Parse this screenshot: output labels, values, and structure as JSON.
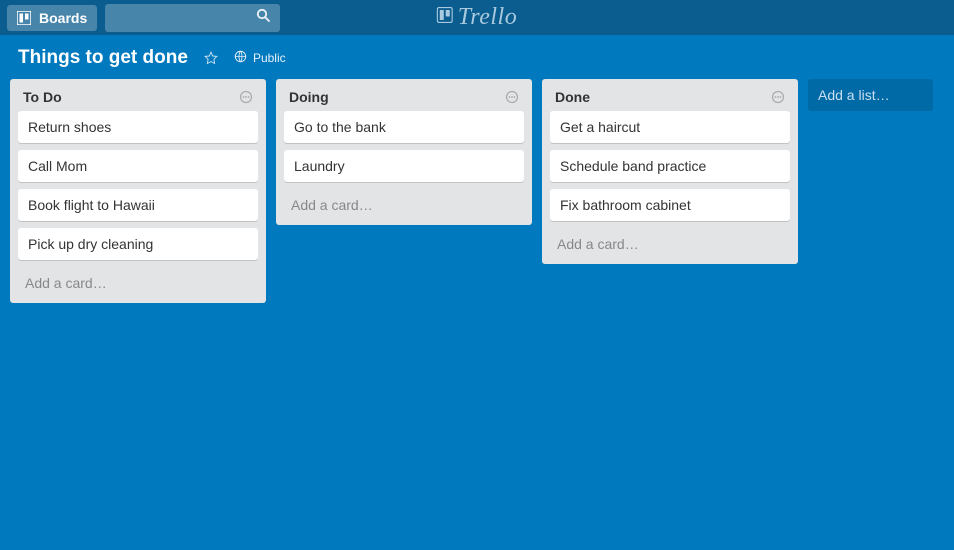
{
  "brand": "Trello",
  "header": {
    "boards_label": "Boards"
  },
  "board": {
    "title": "Things to get done",
    "visibility": "Public"
  },
  "lists": [
    {
      "title": "To Do",
      "cards": [
        "Return shoes",
        "Call Mom",
        "Book flight to Hawaii",
        "Pick up dry cleaning"
      ],
      "add_label": "Add a card…"
    },
    {
      "title": "Doing",
      "cards": [
        "Go to the bank",
        "Laundry"
      ],
      "add_label": "Add a card…"
    },
    {
      "title": "Done",
      "cards": [
        "Get a haircut",
        "Schedule band practice",
        "Fix bathroom cabinet"
      ],
      "add_label": "Add a card…"
    }
  ],
  "add_list_label": "Add a list…"
}
